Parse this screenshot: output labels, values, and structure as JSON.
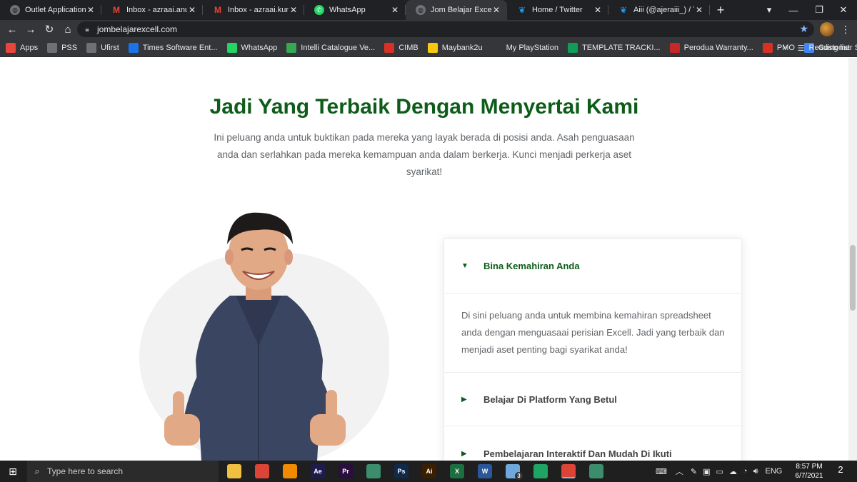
{
  "browser": {
    "tabs": [
      {
        "title": "Outlet Application Sal",
        "icon": "globe-icon"
      },
      {
        "title": "Inbox - azraai.anuar@",
        "icon": "gmail-icon"
      },
      {
        "title": "Inbox - azraai.kun@g",
        "icon": "gmail-icon"
      },
      {
        "title": "WhatsApp",
        "icon": "whatsapp-icon"
      },
      {
        "title": "Jom Belajar Excell – Sp",
        "icon": "globe-icon",
        "active": true
      },
      {
        "title": "Home / Twitter",
        "icon": "twitter-icon"
      },
      {
        "title": "Aiii (@ajeraiii_) / Twitt",
        "icon": "twitter-icon"
      }
    ],
    "url": "jombelajarexcell.com",
    "bookmarks": [
      {
        "label": "Apps",
        "icon": "apps-grid-icon",
        "color": "#e8453c"
      },
      {
        "label": "PSS",
        "icon": "globe-icon",
        "color": "#6e7075"
      },
      {
        "label": "Ufirst",
        "icon": "globe-icon",
        "color": "#6e7075"
      },
      {
        "label": "Times Software Ent...",
        "icon": "ts-icon",
        "color": "#1a73e8"
      },
      {
        "label": "WhatsApp",
        "icon": "whatsapp-icon",
        "color": "#25d366"
      },
      {
        "label": "Intelli Catalogue Ve...",
        "icon": "intelli-icon",
        "color": "#34a853"
      },
      {
        "label": "CIMB",
        "icon": "cimb-icon",
        "color": "#d93025"
      },
      {
        "label": "Maybank2u",
        "icon": "maybank-icon",
        "color": "#f9c80e"
      },
      {
        "label": "My PlayStation",
        "icon": "playstation-icon",
        "color": "#35363a"
      },
      {
        "label": "TEMPLATE TRACKI...",
        "icon": "sheets-icon",
        "color": "#0f9d58"
      },
      {
        "label": "Perodua Warranty...",
        "icon": "perodua-icon",
        "color": "#c62828"
      },
      {
        "label": "PMO",
        "icon": "pmo-icon",
        "color": "#d93025"
      },
      {
        "label": "Customer Survey",
        "icon": "forms-icon",
        "color": "#4285f4"
      }
    ],
    "overflow_label": "»",
    "reading_list_label": "Reading list"
  },
  "page": {
    "heading": "Jadi Yang Terbaik Dengan Menyertai Kami",
    "intro": "Ini peluang anda untuk buktikan pada mereka yang layak berada di posisi anda. Asah penguasaan anda dan serlahkan pada mereka kemampuan anda dalam berkerja. Kunci menjadi perkerja aset syarikat!",
    "accordion": [
      {
        "title": "Bina Kemahiran Anda",
        "expanded": true,
        "body": "Di sini peluang anda untuk membina kemahiran spreadsheet anda dengan  menguasaai perisian Excell. Jadi yang terbaik dan menjadi aset penting bagi syarikat anda!"
      },
      {
        "title": "Belajar Di Platform Yang Betul",
        "expanded": false
      },
      {
        "title": "Pembelajaran Interaktif Dan Mudah Di Ikuti",
        "expanded": false
      }
    ],
    "brand_color": "#0d5c1a"
  },
  "taskbar": {
    "search_placeholder": "Type here to search",
    "apps": [
      "file-explorer-icon",
      "chrome-icon",
      "vlc-icon",
      "after-effects-icon",
      "premiere-icon",
      "app-icon",
      "photoshop-icon",
      "illustrator-icon",
      "excel-icon",
      "word-icon",
      "files-icon",
      "google-drive-icon",
      "chrome-icon",
      "app-icon"
    ],
    "badge_count": "3",
    "language": "ENG",
    "time": "8:57 PM",
    "date": "6/7/2021",
    "notification_count": "2"
  }
}
